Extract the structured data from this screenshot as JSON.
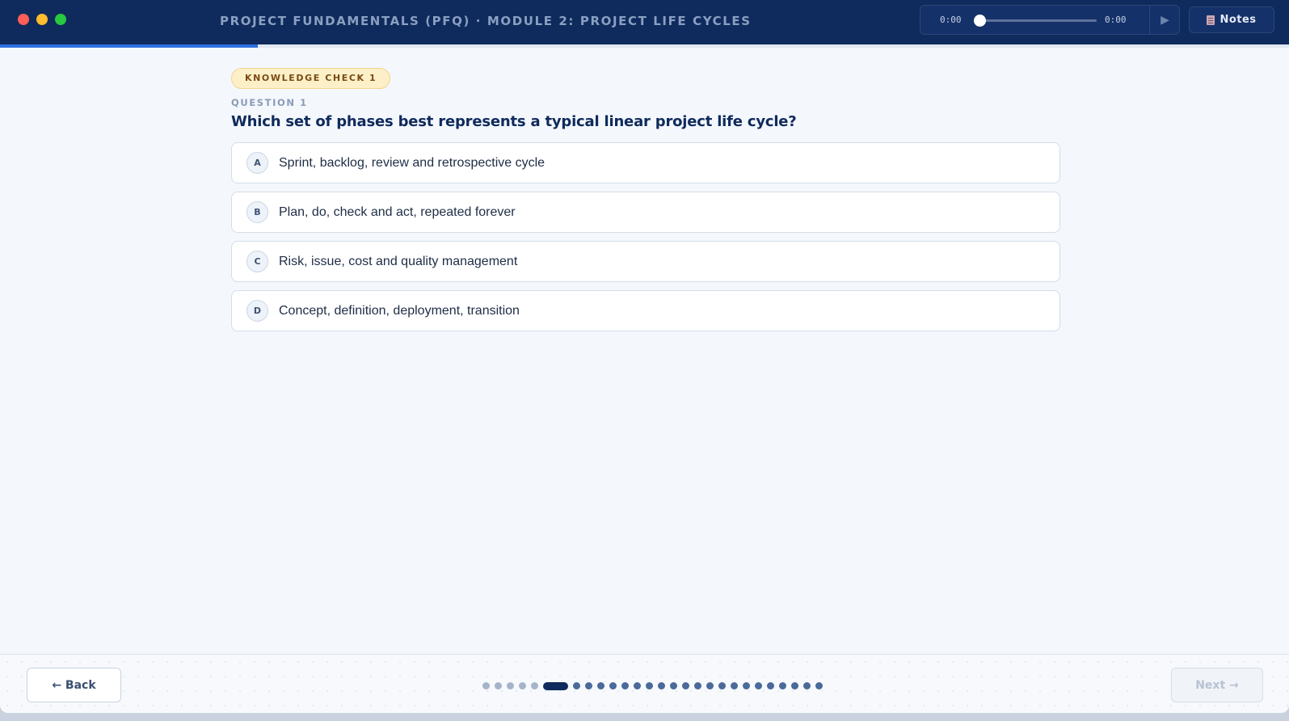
{
  "window": {
    "course_title": "PROJECT FUNDAMENTALS (PFQ) · MODULE 2: PROJECT LIFE CYCLES"
  },
  "audio": {
    "time_current": "0:00",
    "time_total": "0:00",
    "progress": 0
  },
  "notes_button": {
    "label": "Notes",
    "icon": "document-icon"
  },
  "course_progress": 0.2,
  "question": {
    "badge": "KNOWLEDGE CHECK 1",
    "number_label": "QUESTION 1",
    "text": "Which set of phases best represents a typical linear project life cycle?",
    "options": [
      {
        "letter": "A",
        "text": "Sprint, backlog, review and retrospective cycle"
      },
      {
        "letter": "B",
        "text": "Plan, do, check and act, repeated forever"
      },
      {
        "letter": "C",
        "text": "Risk, issue, cost and quality management"
      },
      {
        "letter": "D",
        "text": "Concept, definition, deployment, transition"
      }
    ]
  },
  "footer": {
    "back_label": "← Back",
    "next_label": "Next →",
    "slides_total": 27,
    "slides_completed": 5,
    "slide_current": 6
  },
  "colors": {
    "titlebar": "#0f2a5c",
    "accent": "#2f6ee0",
    "badge_bg": "#fdf0c8",
    "badge_text": "#7a4a12"
  }
}
